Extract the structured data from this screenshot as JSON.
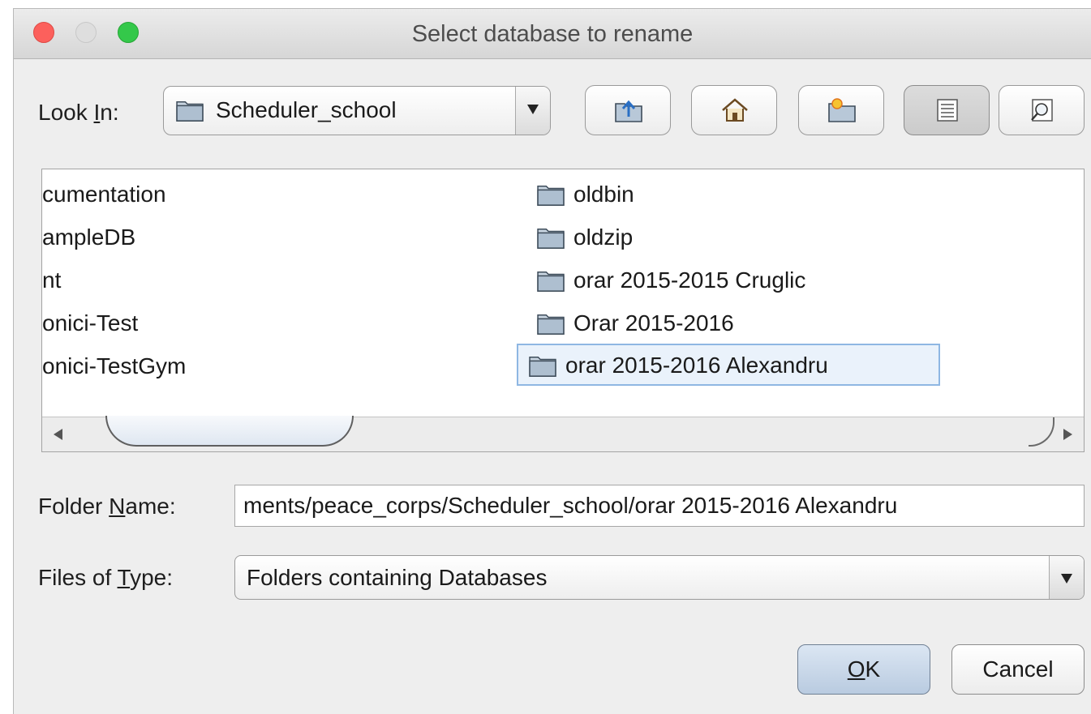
{
  "window": {
    "title": "Select database to rename"
  },
  "look_in": {
    "label_prefix": "Look ",
    "label_mnemonic": "I",
    "label_suffix": "n:",
    "value": "Scheduler_school"
  },
  "toolbar": {
    "buttons": [
      "up-one-level-icon",
      "home-icon",
      "new-folder-icon",
      "list-view-icon",
      "details-view-icon"
    ]
  },
  "file_list": {
    "left_column": [
      "cumentation",
      "ampleDB",
      "nt",
      "onici-Test",
      "onici-TestGym"
    ],
    "right_column": [
      "oldbin",
      "oldzip",
      "orar 2015-2015 Cruglic",
      "Orar 2015-2016",
      "orar 2015-2016 Alexandru"
    ],
    "selected": "orar 2015-2016 Alexandru"
  },
  "folder_name": {
    "label_prefix": "Folder ",
    "label_mnemonic": "N",
    "label_suffix": "ame:",
    "value": "ments/peace_corps/Scheduler_school/orar 2015-2016 Alexandru"
  },
  "files_of_type": {
    "label_prefix": "Files of ",
    "label_mnemonic": "T",
    "label_suffix": "ype:",
    "value": "Folders containing Databases"
  },
  "buttons": {
    "ok_mnemonic": "O",
    "ok_suffix": "K",
    "cancel": "Cancel"
  },
  "colors": {
    "selection_border": "#8fb7e3",
    "ok_button": "#c9d8ea"
  }
}
